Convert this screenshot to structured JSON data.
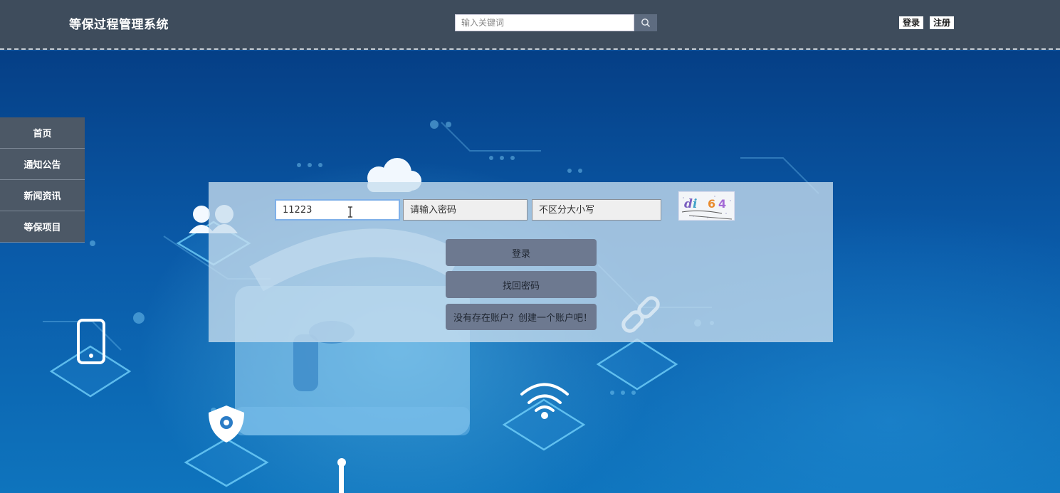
{
  "header": {
    "site_title": "等保过程管理系统",
    "search_placeholder": "输入关键词",
    "login_label": "登录",
    "register_label": "注册"
  },
  "sidebar": {
    "items": [
      {
        "label": "首页"
      },
      {
        "label": "通知公告"
      },
      {
        "label": "新闻资讯"
      },
      {
        "label": "等保项目"
      }
    ]
  },
  "login_form": {
    "username_value": "11223",
    "password_placeholder": "请输入密码",
    "captcha_placeholder": "不区分大小写",
    "captcha_text": "di 64",
    "login_button": "登录",
    "forgot_button": "找回密码",
    "register_link": "没有存在账户？创建一个账户吧！"
  },
  "icons": {
    "search": "search-icon",
    "users": "users-icon",
    "cloud": "cloud-icon",
    "lock": "lock-icon",
    "phone": "phone-icon",
    "shield": "shield-icon",
    "wifi": "wifi-icon",
    "link": "link-icon"
  },
  "colors": {
    "header_bg": "#3e4c5c",
    "sidebar_bg": "#4c5866",
    "button_bg": "#6d7990",
    "page_bg": "#0a5aa8"
  }
}
